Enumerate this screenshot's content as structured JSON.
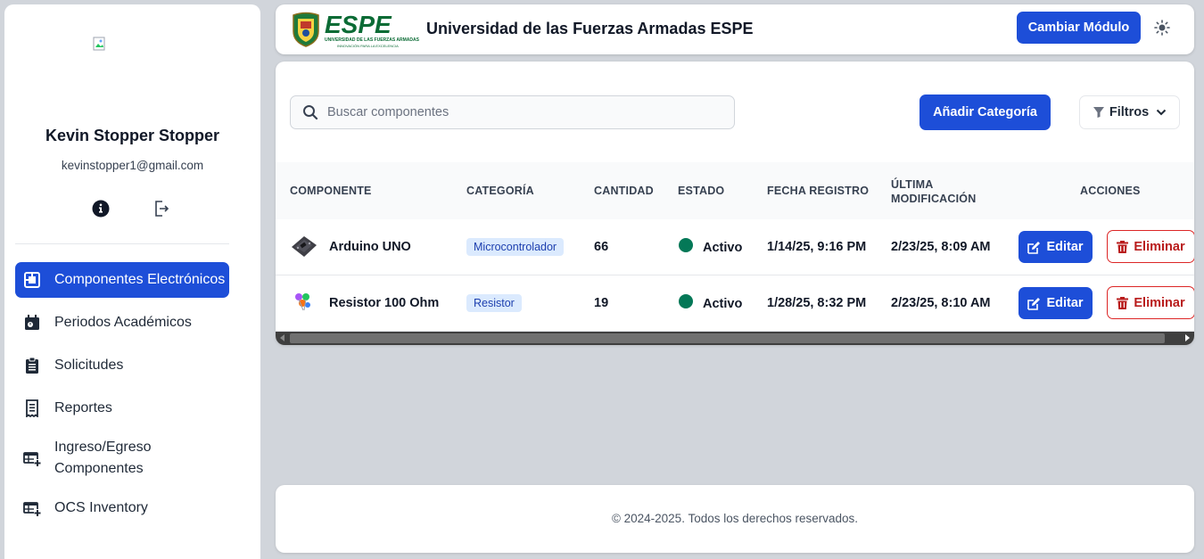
{
  "user": {
    "name": "Kevin Stopper Stopper",
    "email": "kevinstopper1@gmail.com"
  },
  "sidebar": {
    "items": [
      {
        "label": "Componentes Electrónicos",
        "icon": "chip-icon",
        "active": true
      },
      {
        "label": "Periodos Académicos",
        "icon": "calendar-icon",
        "active": false
      },
      {
        "label": "Solicitudes",
        "icon": "clipboard-icon",
        "active": false
      },
      {
        "label": "Reportes",
        "icon": "receipt-icon",
        "active": false
      },
      {
        "label": "Ingreso/Egreso Componentes",
        "icon": "table-plus-icon",
        "active": false
      },
      {
        "label": "OCS Inventory",
        "icon": "table-plus-icon",
        "active": false
      }
    ]
  },
  "header": {
    "title": "Universidad de las Fuerzas Armadas ESPE",
    "logo_text": "ESPE",
    "logo_subtitle": "UNIVERSIDAD DE LAS FUERZAS ARMADAS",
    "logo_tagline": "INNOVACIÓN PARA LA EXCELENCIA",
    "module_button": "Cambiar Módulo"
  },
  "toolbar": {
    "search_placeholder": "Buscar componentes",
    "add_button": "Añadir Categoría",
    "filter_button": "Filtros"
  },
  "table": {
    "columns": {
      "component": "COMPONENTE",
      "category": "CATEGORÍA",
      "quantity": "CANTIDAD",
      "status": "ESTADO",
      "registered": "FECHA REGISTRO",
      "modified": "ÚLTIMA MODIFICACIÓN",
      "actions": "ACCIONES"
    },
    "rows": [
      {
        "name": "Arduino UNO",
        "category": "Microcontrolador",
        "quantity": "66",
        "status": "Activo",
        "registered": "1/14/25, 9:16 PM",
        "modified": "2/23/25, 8:09 AM",
        "edit": "Editar",
        "delete": "Eliminar"
      },
      {
        "name": "Resistor 100 Ohm",
        "category": "Resistor",
        "quantity": "19",
        "status": "Activo",
        "registered": "1/28/25, 8:32 PM",
        "modified": "2/23/25, 8:10 AM",
        "edit": "Editar",
        "delete": "Eliminar"
      }
    ]
  },
  "footer": {
    "text": "© 2024-2025. Todos los derechos reservados."
  },
  "colors": {
    "primary": "#1d4ed8",
    "danger": "#dc2626",
    "status_active": "#047857",
    "brand_green": "#0b6b35"
  }
}
